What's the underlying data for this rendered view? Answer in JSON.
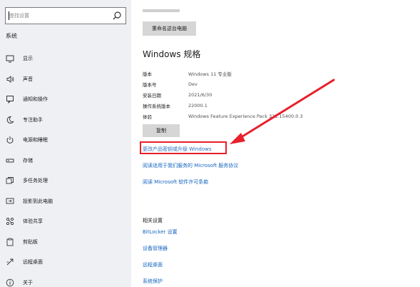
{
  "search": {
    "placeholder": "查找设置"
  },
  "sidebar": {
    "section_title": "系统",
    "items": [
      {
        "label": "显示",
        "icon": "monitor-icon"
      },
      {
        "label": "声音",
        "icon": "speaker-icon"
      },
      {
        "label": "通知和操作",
        "icon": "notification-icon"
      },
      {
        "label": "专注助手",
        "icon": "moon-icon"
      },
      {
        "label": "电源和睡眠",
        "icon": "power-icon"
      },
      {
        "label": "存储",
        "icon": "storage-icon"
      },
      {
        "label": "多任务处理",
        "icon": "multitask-icon"
      },
      {
        "label": "投影到此电脑",
        "icon": "projection-icon"
      },
      {
        "label": "体验共享",
        "icon": "share-icon"
      },
      {
        "label": "剪贴板",
        "icon": "clipboard-icon"
      },
      {
        "label": "远程桌面",
        "icon": "remote-desktop-icon"
      },
      {
        "label": "关于",
        "icon": "info-icon"
      }
    ]
  },
  "main": {
    "rename_button": "重命名这台电脑",
    "spec_heading": "Windows 规格",
    "specs": [
      {
        "key": "版本",
        "value": "Windows 11 专业版"
      },
      {
        "key": "版本号",
        "value": "Dev"
      },
      {
        "key": "安装日期",
        "value": "2021/6/30"
      },
      {
        "key": "操作系统版本",
        "value": "22000.1"
      },
      {
        "key": "体验",
        "value": "Windows Feature Experience Pack 321.15400.0.3"
      }
    ],
    "copy_button": "复制",
    "links": {
      "change_key": "更改产品密钥或升级 Windows",
      "services_agreement": "阅读适用于我们服务的 Microsoft 服务协议",
      "license_terms": "阅读 Microsoft 软件许可条款"
    },
    "related_heading": "相关设置",
    "related_links": [
      "BitLocker 设置",
      "设备管理器",
      "远程桌面",
      "系统保护"
    ]
  },
  "colors": {
    "sidebar_bg": "#eef0f3",
    "link": "#1565c0",
    "highlight": "#e8202c"
  }
}
